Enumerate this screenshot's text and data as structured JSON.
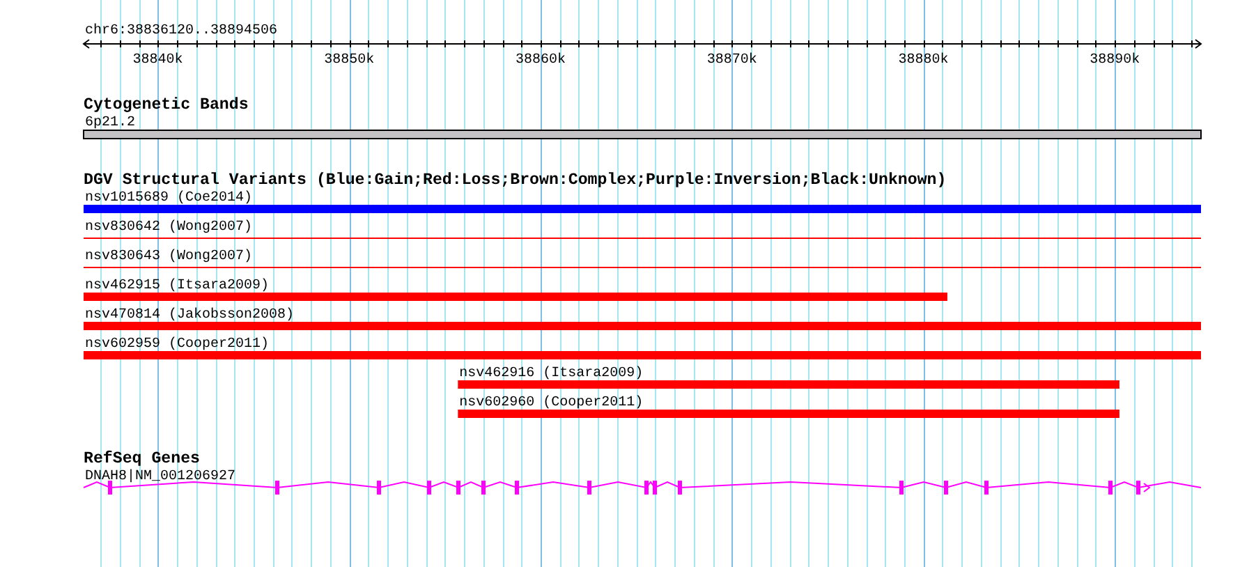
{
  "ruler": {
    "title": "chr6:38836120..38894506",
    "tick_labels": [
      "38840k",
      "38850k",
      "38860k",
      "38870k",
      "38880k",
      "38890k"
    ]
  },
  "tracks": [
    {
      "kind": "cytoband",
      "title": "Cytogenetic Bands",
      "features": [
        {
          "label": "6p21.2"
        }
      ]
    },
    {
      "kind": "variants",
      "title": "DGV Structural Variants (Blue:Gain;Red:Loss;Brown:Complex;Purple:Inversion;Black:Unknown)",
      "features": [
        {
          "label": "nsv1015689 (Coe2014)",
          "color": "#0000ff",
          "kind": "thick"
        },
        {
          "label": "nsv830642 (Wong2007)",
          "color": "#ff0000",
          "kind": "thin"
        },
        {
          "label": "nsv830643 (Wong2007)",
          "color": "#ff0000",
          "kind": "thin"
        },
        {
          "label": "nsv462915 (Itsara2009)",
          "color": "#ff0000",
          "kind": "thick"
        },
        {
          "label": "nsv470814 (Jakobsson2008)",
          "color": "#ff0000",
          "kind": "thick"
        },
        {
          "label": "nsv602959 (Cooper2011)",
          "color": "#ff0000",
          "kind": "thick"
        },
        {
          "label": "nsv462916 (Itsara2009)",
          "color": "#ff0000",
          "kind": "thick"
        },
        {
          "label": "nsv602960 (Cooper2011)",
          "color": "#ff0000",
          "kind": "thick"
        }
      ]
    },
    {
      "kind": "genes",
      "title": "RefSeq Genes",
      "features": [
        {
          "label": "DNAH8|NM_001206927"
        }
      ]
    }
  ]
}
